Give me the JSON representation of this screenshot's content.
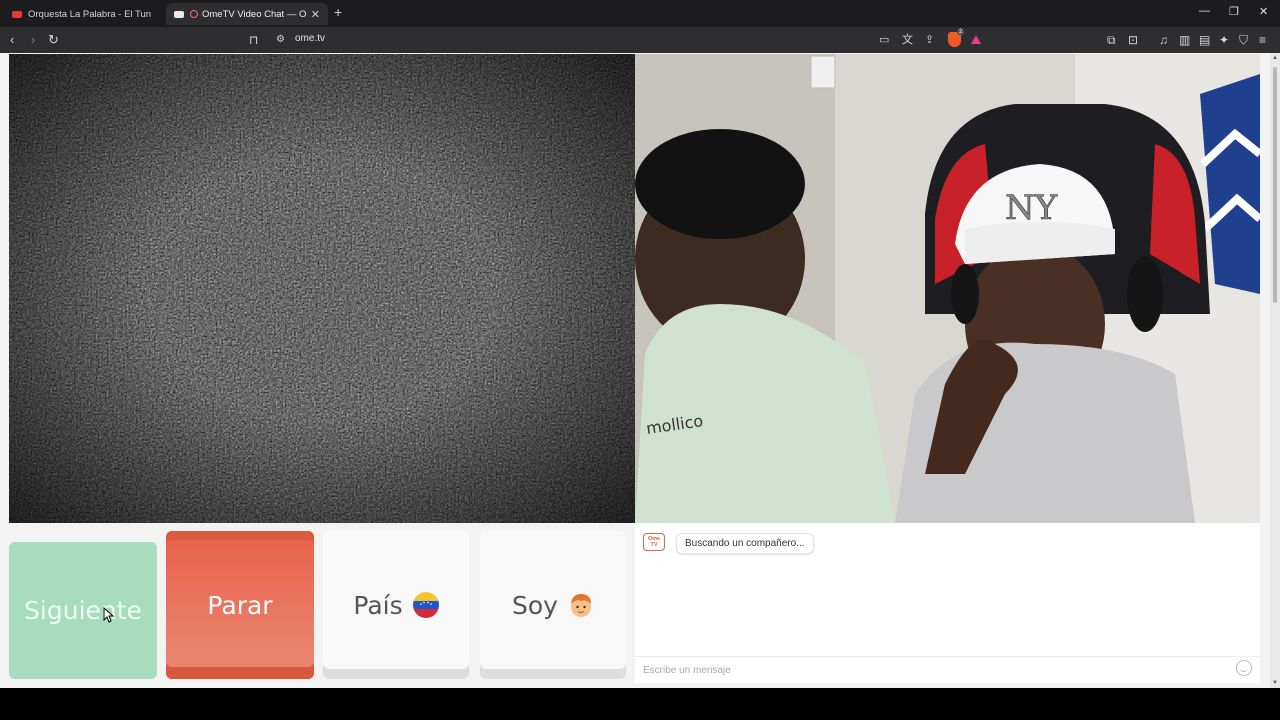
{
  "browser": {
    "tabs": [
      {
        "label": "Orquesta La Palabra - El Tun Tun De",
        "icon": "youtube-icon"
      },
      {
        "label": "OmeTV Video Chat — Omeg",
        "icon": "ometv-favicon-icon",
        "active": true
      }
    ],
    "url": "ome.tv",
    "shield_badge": "2"
  },
  "controls": {
    "next_label": "Siguiente",
    "stop_label": "Parar",
    "country_label": "País",
    "gender_label": "Soy"
  },
  "chat": {
    "logo_text": "Ome TV",
    "status_message": "Buscando un compañero...",
    "input_placeholder": "Escribe un mensaje"
  },
  "colors": {
    "next_button": "#a8dcbf",
    "stop_button": "#e8604a",
    "brand": "#e2624a"
  }
}
